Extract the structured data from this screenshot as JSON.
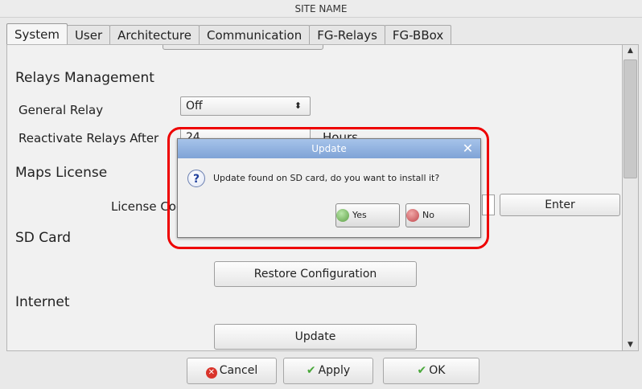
{
  "window": {
    "title": "SITE NAME"
  },
  "tabs": [
    {
      "label": "System"
    },
    {
      "label": "User"
    },
    {
      "label": "Architecture"
    },
    {
      "label": "Communication"
    },
    {
      "label": "FG-Relays"
    },
    {
      "label": "FG-BBox"
    }
  ],
  "relays": {
    "section_title": "Relays Management",
    "general_relay_label": "General Relay",
    "general_relay_value": "Off",
    "reactivate_label": "Reactivate Relays After",
    "reactivate_value": "24",
    "reactivate_unit": "Hours"
  },
  "maps": {
    "section_title": "Maps License",
    "license_label": "License Code",
    "enter_button": "Enter"
  },
  "sd_card": {
    "section_title": "SD Card",
    "restore_button": "Restore Configuration"
  },
  "internet": {
    "section_title": "Internet",
    "update_button": "Update"
  },
  "dialog": {
    "title": "Update",
    "message": "Update found on SD card, do you want to install it?",
    "yes_label": "Yes",
    "no_label": "No",
    "icon": "question-icon",
    "close_icon": "close-icon"
  },
  "bottom": {
    "cancel_label": "Cancel",
    "apply_label": "Apply",
    "ok_label": "OK"
  },
  "colors": {
    "highlight": "#e00000",
    "dialog_title_bg": "#8fb1df"
  }
}
